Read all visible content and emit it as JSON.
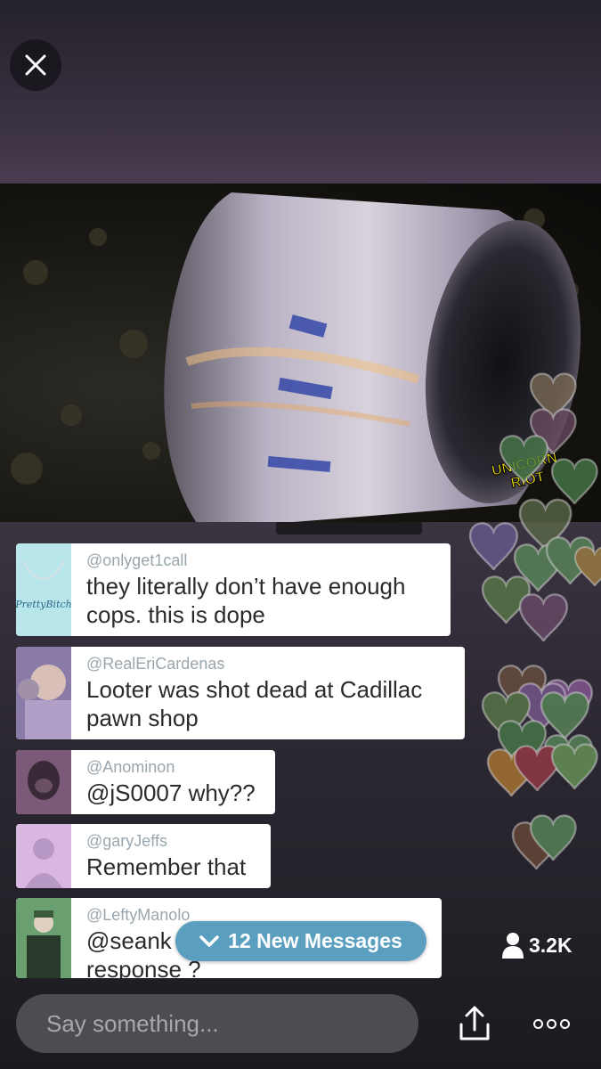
{
  "broadcast": {
    "watermark_line1": "UNICORN",
    "watermark_line2": "RIOT",
    "viewer_count": "3.2K"
  },
  "chat": [
    {
      "username": "@onlyget1call",
      "text": "they literally don’t have enough cops. this is dope",
      "avatar_text": "PrettyBitch",
      "avatar_color": "#b8e6ea"
    },
    {
      "username": "@RealEriCardenas",
      "text": "Looter was shot dead at Cadillac pawn shop",
      "avatar_color": "#8a7aa8"
    },
    {
      "username": "@Anominon",
      "text": "@jS0007 why??",
      "avatar_color": "#7a5a78"
    },
    {
      "username": "@garyJeffs",
      "text": "Remember that",
      "avatar_color": "#d8b8e0"
    },
    {
      "username": "@LeftyManolo",
      "text": "@seank… response ?",
      "text_line1": "@seank",
      "text_line2": "response ?",
      "avatar_color": "#6aa070"
    }
  ],
  "new_messages": {
    "label": "12 New Messages"
  },
  "composer": {
    "placeholder": "Say something..."
  },
  "colors": {
    "pill": "#5b9fc0",
    "hearts": [
      "#8a7a5a",
      "#7a5a70",
      "#5a8a5a",
      "#7a6aa0",
      "#8aa060",
      "#c08a50",
      "#a05060",
      "#80a080"
    ]
  }
}
